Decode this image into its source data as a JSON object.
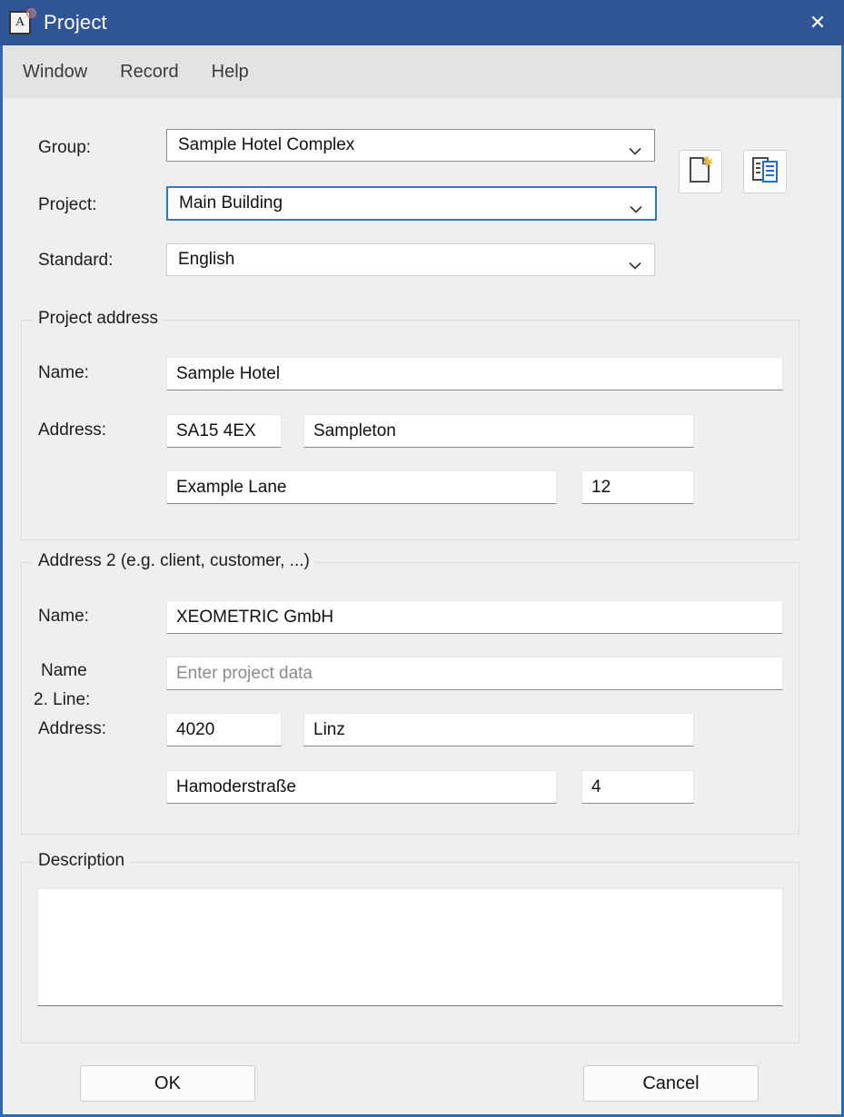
{
  "window": {
    "title": "Project",
    "title_icon": "document-A-icon",
    "close_label": "✕",
    "accent_border_color": "#2a6bb5",
    "titlebar_color": "#2f5597"
  },
  "menubar": {
    "items": [
      {
        "label": "Window"
      },
      {
        "label": "Record"
      },
      {
        "label": "Help"
      }
    ]
  },
  "selectors": {
    "group": {
      "label": "Group:",
      "value": "Sample Hotel Complex"
    },
    "project": {
      "label": "Project:",
      "value": "Main Building"
    },
    "standard": {
      "label": "Standard:",
      "value": "English"
    }
  },
  "toolbar": {
    "new_project_icon": "new-document-icon",
    "copy_project_icon": "copy-document-icon"
  },
  "project_address": {
    "title": "Project address",
    "name_label": "Name:",
    "name_value": "Sample Hotel",
    "address_label": "Address:",
    "zip_value": "SA15 4EX",
    "city_value": "Sampleton",
    "street_value": "Example Lane",
    "number_value": "12"
  },
  "address2": {
    "title": "Address 2 (e.g. client, customer, ...)",
    "name_label": "Name:",
    "name_value": "XEOMETRIC GmbH",
    "name2_label_line1": "Name",
    "name2_label_line2": "2. Line:",
    "name2_placeholder": "Enter project data",
    "name2_value": "",
    "address_label": "Address:",
    "zip_value": "4020",
    "city_value": "Linz",
    "street_value": "Hamoderstraße",
    "number_value": "4"
  },
  "description": {
    "title": "Description",
    "value": ""
  },
  "footer": {
    "ok_label": "OK",
    "cancel_label": "Cancel"
  }
}
